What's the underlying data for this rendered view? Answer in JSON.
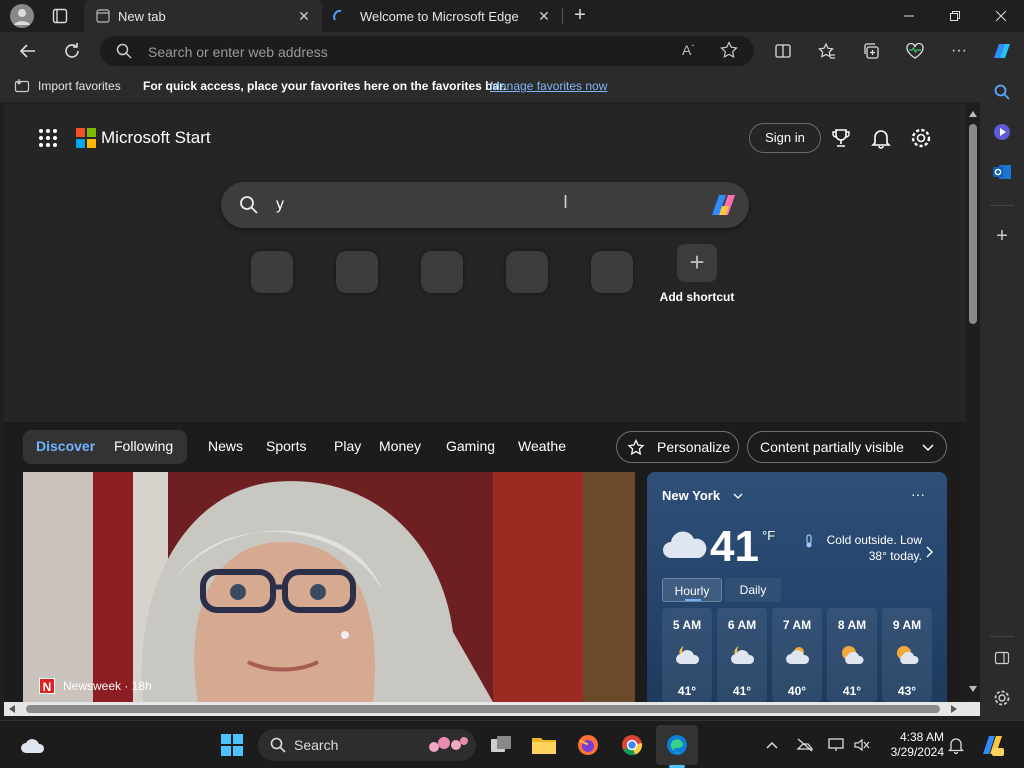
{
  "tabs": [
    {
      "title": "New tab",
      "active": true
    },
    {
      "title": "Welcome to Microsoft Edge",
      "active": false
    }
  ],
  "address": {
    "placeholder": "Search or enter web address"
  },
  "favorites_bar": {
    "import_label": "Import favorites",
    "message": "For quick access, place your favorites here on the favorites bar.",
    "link": "Manage favorites now"
  },
  "header": {
    "brand": "Microsoft Start",
    "sign_in": "Sign in"
  },
  "search": {
    "value": "y"
  },
  "shortcuts": {
    "add_label": "Add shortcut"
  },
  "news_nav": {
    "segments": [
      "Discover",
      "Following"
    ],
    "items": [
      "News",
      "Sports",
      "Play",
      "Money",
      "Gaming",
      "Weathe"
    ],
    "personalize": "Personalize",
    "content_visibility": "Content partially visible"
  },
  "article": {
    "source": "Newsweek · 18h"
  },
  "weather": {
    "city": "New York",
    "temp": "41",
    "unit": "°F",
    "summary": "Cold outside. Low 38° today.",
    "tabs": [
      "Hourly",
      "Daily"
    ],
    "hourly": [
      {
        "time": "5 AM",
        "temp": "41°"
      },
      {
        "time": "6 AM",
        "temp": "41°"
      },
      {
        "time": "7 AM",
        "temp": "40°"
      },
      {
        "time": "8 AM",
        "temp": "41°"
      },
      {
        "time": "9 AM",
        "temp": "43°"
      }
    ]
  },
  "taskbar": {
    "search_label": "Search",
    "time": "4:38 AM",
    "date": "3/29/2024"
  },
  "colors": {
    "accent": "#6fb3ff",
    "link": "#7fb6f5"
  }
}
